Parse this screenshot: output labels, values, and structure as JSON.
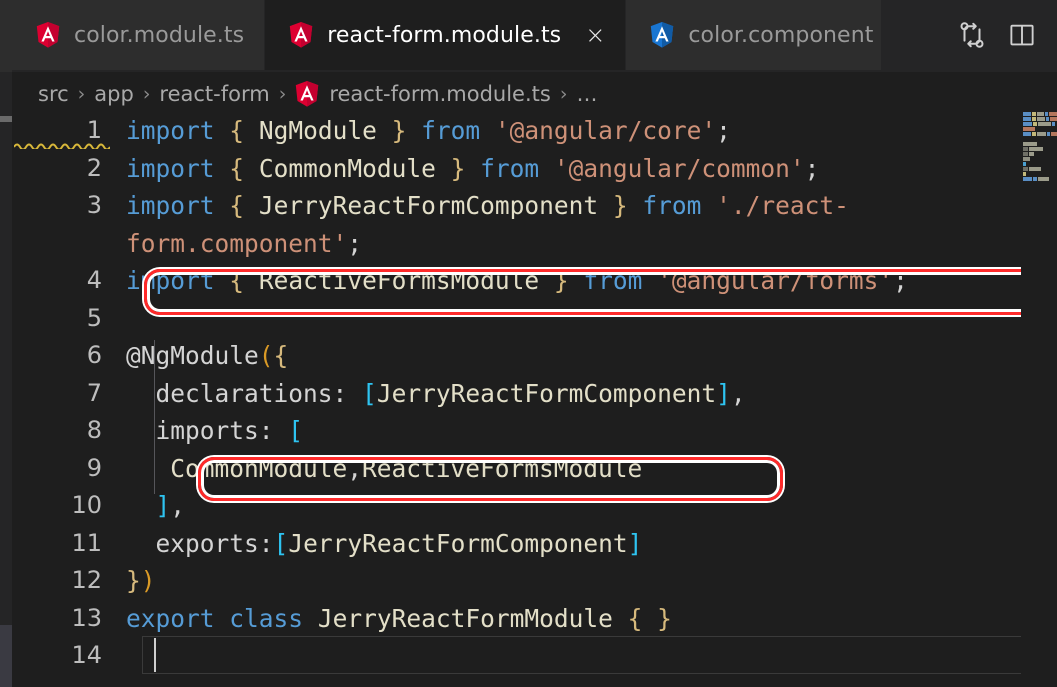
{
  "window": {
    "theme_bg": "#1e1e1e",
    "accent_red": "#ff2a2a"
  },
  "tabs": [
    {
      "label": "color.module.ts",
      "icon": "angular-module-icon",
      "icon_color": "#dd0031",
      "active": false,
      "closable": false
    },
    {
      "label": "react-form.module.ts",
      "icon": "angular-module-icon",
      "icon_color": "#dd0031",
      "active": true,
      "closable": true,
      "close_label": "×"
    },
    {
      "label": "color.component",
      "icon": "angular-component-icon",
      "icon_color": "#1976d2",
      "active": false,
      "closable": false
    }
  ],
  "tabbar_actions": [
    {
      "name": "compare-changes-icon",
      "title": "Open Changes"
    },
    {
      "name": "split-editor-icon",
      "title": "Split Editor"
    }
  ],
  "breadcrumb": {
    "separator": "›",
    "items": [
      {
        "label": "src",
        "icon": null
      },
      {
        "label": "app",
        "icon": null
      },
      {
        "label": "react-form",
        "icon": null
      },
      {
        "label": "react-form.module.ts",
        "icon": "angular-module-icon"
      },
      {
        "label": "…",
        "icon": null
      }
    ]
  },
  "editor": {
    "language": "typescript",
    "cursor_line": 14,
    "lines": [
      {
        "number": "1",
        "tokens": [
          {
            "t": "import",
            "c": "kw"
          },
          {
            "t": " ",
            "c": "plain"
          },
          {
            "t": "{",
            "c": "brc"
          },
          {
            "t": " ",
            "c": "plain"
          },
          {
            "t": "NgModule",
            "c": "id"
          },
          {
            "t": " ",
            "c": "plain"
          },
          {
            "t": "}",
            "c": "brc"
          },
          {
            "t": " ",
            "c": "plain"
          },
          {
            "t": "from",
            "c": "kw"
          },
          {
            "t": " ",
            "c": "plain"
          },
          {
            "t": "'@angular/core'",
            "c": "str"
          },
          {
            "t": ";",
            "c": "plain"
          }
        ]
      },
      {
        "number": "2",
        "tokens": [
          {
            "t": "import",
            "c": "kw"
          },
          {
            "t": " ",
            "c": "plain"
          },
          {
            "t": "{",
            "c": "brc"
          },
          {
            "t": " ",
            "c": "plain"
          },
          {
            "t": "CommonModule",
            "c": "id"
          },
          {
            "t": " ",
            "c": "plain"
          },
          {
            "t": "}",
            "c": "brc"
          },
          {
            "t": " ",
            "c": "plain"
          },
          {
            "t": "from",
            "c": "kw"
          },
          {
            "t": " ",
            "c": "plain"
          },
          {
            "t": "'@angular/common'",
            "c": "str"
          },
          {
            "t": ";",
            "c": "plain"
          }
        ]
      },
      {
        "number": "3",
        "wrapped": true,
        "tokens": [
          {
            "t": "import",
            "c": "kw"
          },
          {
            "t": " ",
            "c": "plain"
          },
          {
            "t": "{",
            "c": "brc"
          },
          {
            "t": " ",
            "c": "plain"
          },
          {
            "t": "JerryReactFormComponent",
            "c": "id"
          },
          {
            "t": " ",
            "c": "plain"
          },
          {
            "t": "}",
            "c": "brc"
          },
          {
            "t": " ",
            "c": "plain"
          },
          {
            "t": "from",
            "c": "kw"
          },
          {
            "t": " ",
            "c": "plain"
          },
          {
            "t": "'./react-form.component'",
            "c": "str"
          },
          {
            "t": ";",
            "c": "plain"
          }
        ]
      },
      {
        "number": "4",
        "tokens": [
          {
            "t": "import",
            "c": "kw"
          },
          {
            "t": " ",
            "c": "plain"
          },
          {
            "t": "{",
            "c": "brc"
          },
          {
            "t": " ",
            "c": "plain"
          },
          {
            "t": "ReactiveFormsModule",
            "c": "id"
          },
          {
            "t": " ",
            "c": "plain"
          },
          {
            "t": "}",
            "c": "brc"
          },
          {
            "t": " ",
            "c": "plain"
          },
          {
            "t": "from",
            "c": "kw"
          },
          {
            "t": " ",
            "c": "plain"
          },
          {
            "t": "'@angular/forms'",
            "c": "str"
          },
          {
            "t": ";",
            "c": "plain"
          }
        ]
      },
      {
        "number": "5",
        "tokens": []
      },
      {
        "number": "6",
        "tokens": [
          {
            "t": "@NgModule",
            "c": "plain"
          },
          {
            "t": "(",
            "c": "paren"
          },
          {
            "t": "{",
            "c": "brc"
          }
        ]
      },
      {
        "number": "7",
        "tokens": [
          {
            "t": "  declarations",
            "c": "prop"
          },
          {
            "t": ": ",
            "c": "plain"
          },
          {
            "t": "[",
            "c": "brk"
          },
          {
            "t": "JerryReactFormComponent",
            "c": "id"
          },
          {
            "t": "]",
            "c": "brk"
          },
          {
            "t": ",",
            "c": "plain"
          }
        ]
      },
      {
        "number": "8",
        "tokens": [
          {
            "t": "  imports",
            "c": "prop"
          },
          {
            "t": ": ",
            "c": "plain"
          },
          {
            "t": "[",
            "c": "brk"
          }
        ]
      },
      {
        "number": "9",
        "tokens": [
          {
            "t": "   CommonModule",
            "c": "id"
          },
          {
            "t": ",",
            "c": "plain"
          },
          {
            "t": "ReactiveFormsModule",
            "c": "id"
          }
        ]
      },
      {
        "number": "10",
        "tokens": [
          {
            "t": "  ",
            "c": "plain"
          },
          {
            "t": "]",
            "c": "brk"
          },
          {
            "t": ",",
            "c": "plain"
          }
        ]
      },
      {
        "number": "11",
        "tokens": [
          {
            "t": "  exports",
            "c": "prop"
          },
          {
            "t": ":",
            "c": "plain"
          },
          {
            "t": "[",
            "c": "brk"
          },
          {
            "t": "JerryReactFormComponent",
            "c": "id"
          },
          {
            "t": "]",
            "c": "brk"
          }
        ]
      },
      {
        "number": "12",
        "tokens": [
          {
            "t": "}",
            "c": "brc"
          },
          {
            "t": ")",
            "c": "paren"
          }
        ]
      },
      {
        "number": "13",
        "tokens": [
          {
            "t": "export",
            "c": "kw"
          },
          {
            "t": " ",
            "c": "plain"
          },
          {
            "t": "class",
            "c": "kw"
          },
          {
            "t": " ",
            "c": "plain"
          },
          {
            "t": "JerryReactFormModule",
            "c": "id"
          },
          {
            "t": " ",
            "c": "plain"
          },
          {
            "t": "{",
            "c": "brc"
          },
          {
            "t": " ",
            "c": "plain"
          },
          {
            "t": "}",
            "c": "brc"
          }
        ]
      },
      {
        "number": "14",
        "tokens": []
      }
    ]
  },
  "annotations": [
    {
      "name": "highlight-box-import-reactive-forms",
      "target_line": 4,
      "color": "#ff2a2a"
    },
    {
      "name": "highlight-box-imports-array",
      "target_line": 9,
      "color": "#ff2a2a"
    }
  ],
  "minimap": {
    "rows": [
      [
        {
          "w": 9,
          "c": "#5a8ec4"
        },
        {
          "w": 4,
          "c": "#c2b87a"
        },
        {
          "w": 7,
          "c": "#9b9b8a"
        },
        {
          "w": 3,
          "c": "#5a8ec4"
        },
        {
          "w": 9,
          "c": "#b4765c"
        }
      ],
      [
        {
          "w": 9,
          "c": "#5a8ec4"
        },
        {
          "w": 4,
          "c": "#c2b87a"
        },
        {
          "w": 9,
          "c": "#9b9b8a"
        },
        {
          "w": 3,
          "c": "#5a8ec4"
        },
        {
          "w": 8,
          "c": "#b4765c"
        }
      ],
      [
        {
          "w": 9,
          "c": "#5a8ec4"
        },
        {
          "w": 4,
          "c": "#c2b87a"
        },
        {
          "w": 13,
          "c": "#9b9b8a"
        },
        {
          "w": 3,
          "c": "#5a8ec4"
        }
      ],
      [
        {
          "w": 12,
          "c": "#b4765c"
        }
      ],
      [
        {
          "w": 9,
          "c": "#5a8ec4"
        },
        {
          "w": 4,
          "c": "#c2b87a"
        },
        {
          "w": 10,
          "c": "#9b9b8a"
        },
        {
          "w": 3,
          "c": "#5a8ec4"
        },
        {
          "w": 7,
          "c": "#b4765c"
        }
      ],
      [],
      [
        {
          "w": 14,
          "c": "#9b9b8a"
        }
      ],
      [
        {
          "w": 5,
          "c": "#6f6f66"
        },
        {
          "w": 14,
          "c": "#9b9b8a"
        }
      ],
      [
        {
          "w": 5,
          "c": "#6f6f66"
        },
        {
          "w": 5,
          "c": "#9b9b8a"
        }
      ],
      [
        {
          "w": 7,
          "c": "#8e8e80"
        }
      ],
      [
        {
          "w": 3,
          "c": "#4a9fd0"
        }
      ],
      [
        {
          "w": 5,
          "c": "#6f6f66"
        },
        {
          "w": 12,
          "c": "#9b9b8a"
        }
      ],
      [
        {
          "w": 3,
          "c": "#c2b87a"
        }
      ],
      [
        {
          "w": 9,
          "c": "#5a8ec4"
        },
        {
          "w": 4,
          "c": "#5a8ec4"
        },
        {
          "w": 11,
          "c": "#9b9b8a"
        }
      ]
    ]
  }
}
